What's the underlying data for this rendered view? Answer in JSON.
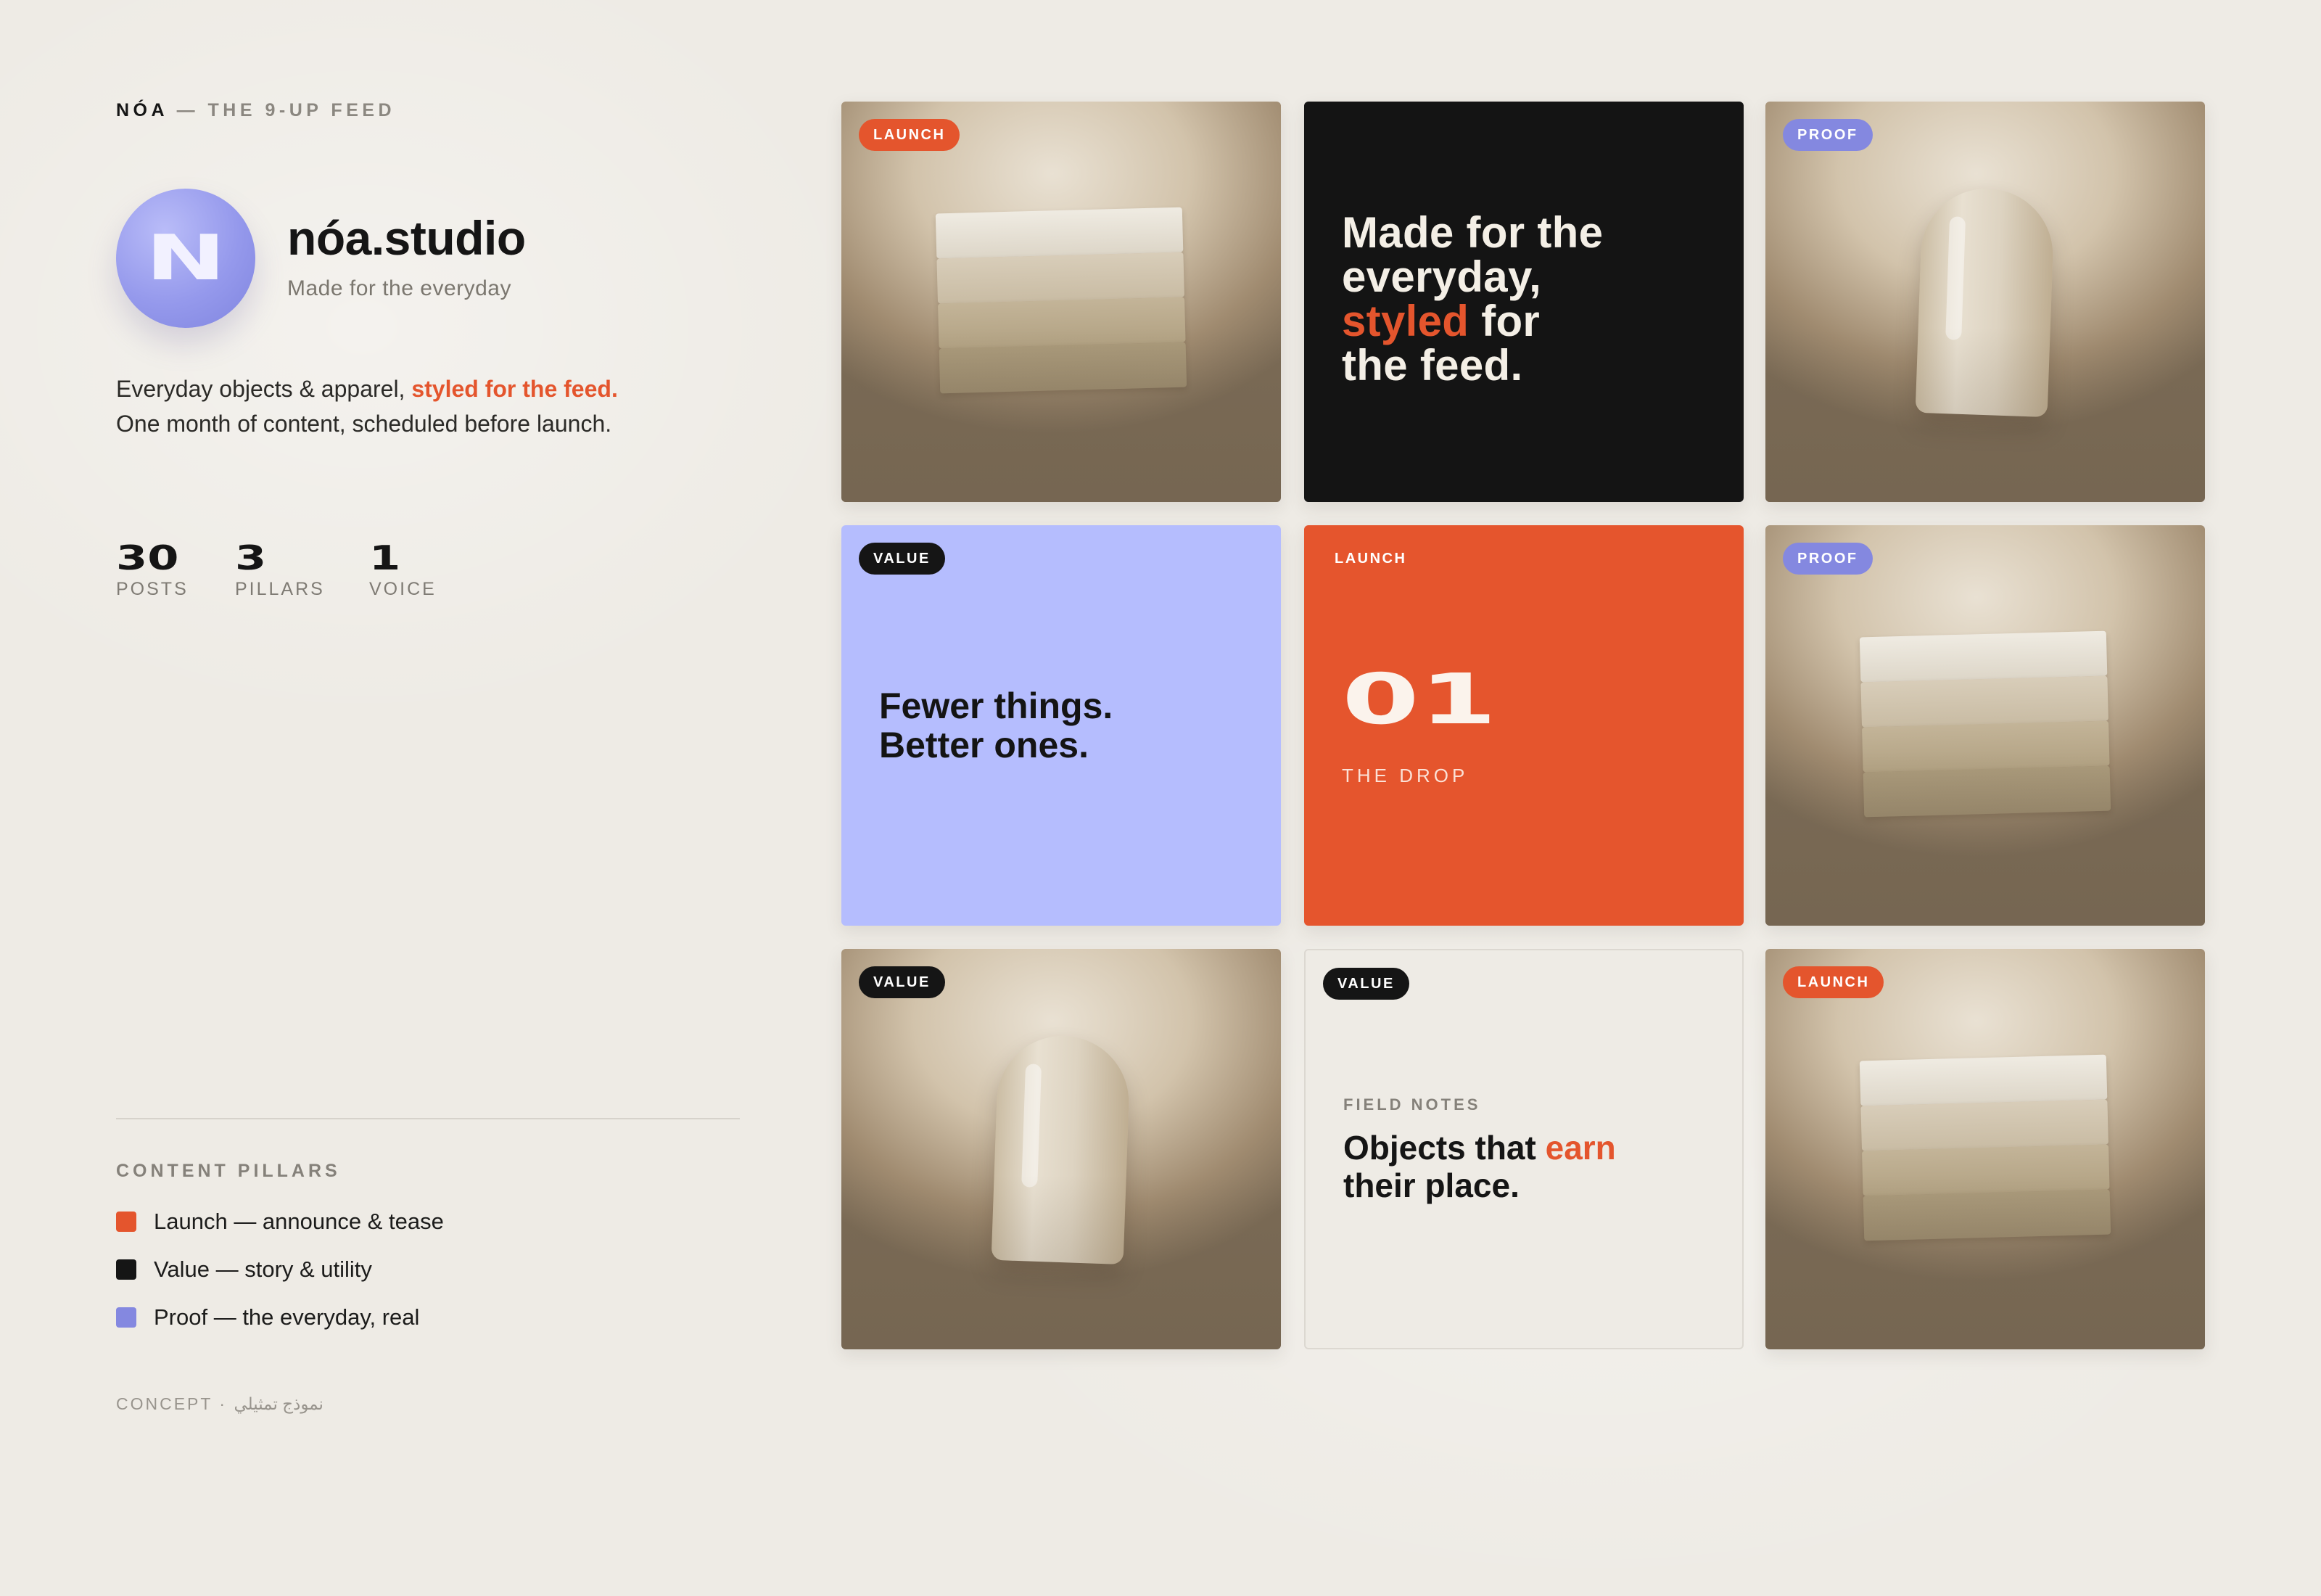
{
  "header": {
    "brand": "NÓA",
    "rest": " — THE 9-UP FEED"
  },
  "profile": {
    "avatar_letter": "N",
    "name": "nóa.studio",
    "tagline": "Made for the everyday",
    "bio_prefix": "Everyday objects & apparel, ",
    "bio_highlight": "styled for the feed.",
    "bio_suffix": "One month of content, scheduled before launch."
  },
  "stats": [
    {
      "value": "30",
      "label": "POSTS"
    },
    {
      "value": "3",
      "label": "PILLARS"
    },
    {
      "value": "1",
      "label": "VOICE"
    }
  ],
  "pillars": {
    "title": "CONTENT PILLARS",
    "items": [
      {
        "label": "Launch — announce & tease",
        "color": "#e4552d"
      },
      {
        "label": "Value — story & utility",
        "color": "#151515"
      },
      {
        "label": "Proof — the everyday, real",
        "color": "#8488e0"
      }
    ]
  },
  "footer": "CONCEPT · نموذج تمثيلي",
  "grid": [
    {
      "badge": "LAUNCH",
      "kind": "photo-stack"
    },
    {
      "kind": "text-dark",
      "line1": "Made for the",
      "line2": "everyday,",
      "accent": "styled",
      "line3_rest": " for",
      "line4": "the feed."
    },
    {
      "badge": "PROOF",
      "kind": "photo-capsule"
    },
    {
      "badge": "VALUE",
      "kind": "text-lavender",
      "line1": "Fewer things.",
      "line2": "Better ones."
    },
    {
      "badge": "LAUNCH",
      "kind": "drop",
      "number": "01",
      "sub": "THE DROP"
    },
    {
      "badge": "PROOF",
      "kind": "photo-stack"
    },
    {
      "badge": "VALUE",
      "kind": "photo-capsule"
    },
    {
      "badge": "VALUE",
      "kind": "text-cream",
      "kicker": "FIELD NOTES",
      "line1_pre": "Objects that ",
      "accent": "earn",
      "line2": "their place."
    },
    {
      "badge": "LAUNCH",
      "kind": "photo-stack"
    }
  ],
  "colors": {
    "accent": "#e4552d",
    "proof": "#8488e0",
    "ink": "#151515",
    "lavender": "#b5bdfe",
    "background": "#eeebe5"
  }
}
